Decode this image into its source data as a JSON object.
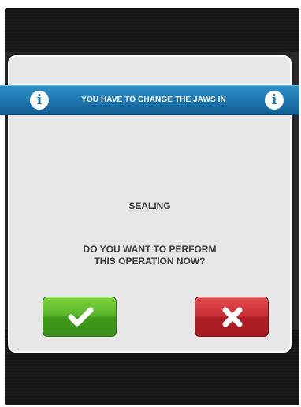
{
  "banner": {
    "title": "YOU HAVE TO CHANGE THE JAWS IN",
    "left_icon": "info-icon",
    "right_icon": "info-icon",
    "info_glyph": "i",
    "color": "#1c74ad"
  },
  "dialog": {
    "subject": "SEALING",
    "question_line1": "DO YOU WANT TO PERFORM",
    "question_line2": "THIS OPERATION NOW?"
  },
  "buttons": {
    "confirm": {
      "icon": "checkmark-icon",
      "color": "#57b52a"
    },
    "cancel": {
      "icon": "close-icon",
      "color": "#c82f34"
    }
  }
}
